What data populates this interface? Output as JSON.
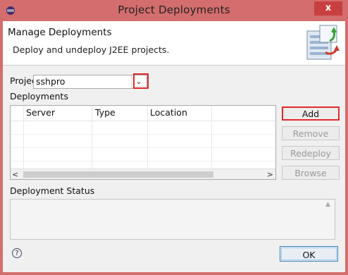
{
  "window": {
    "title": "Project Deployments",
    "close_label": "x"
  },
  "header": {
    "title": "Manage Deployments",
    "description": "Deploy and undeploy J2EE projects."
  },
  "project": {
    "label": "Project",
    "value": "sshpro"
  },
  "deployments": {
    "label": "Deployments",
    "columns": [
      "Server",
      "Type",
      "Location"
    ],
    "rows": []
  },
  "buttons": {
    "add": "Add",
    "remove": "Remove",
    "redeploy": "Redeploy",
    "browse": "Browse",
    "ok": "OK"
  },
  "status": {
    "label": "Deployment Status",
    "text": ""
  },
  "help": {
    "glyph": "?"
  },
  "colors": {
    "highlight": "#e02b2b",
    "title_bar": "#d46d6d",
    "close_button": "#c7403f"
  }
}
